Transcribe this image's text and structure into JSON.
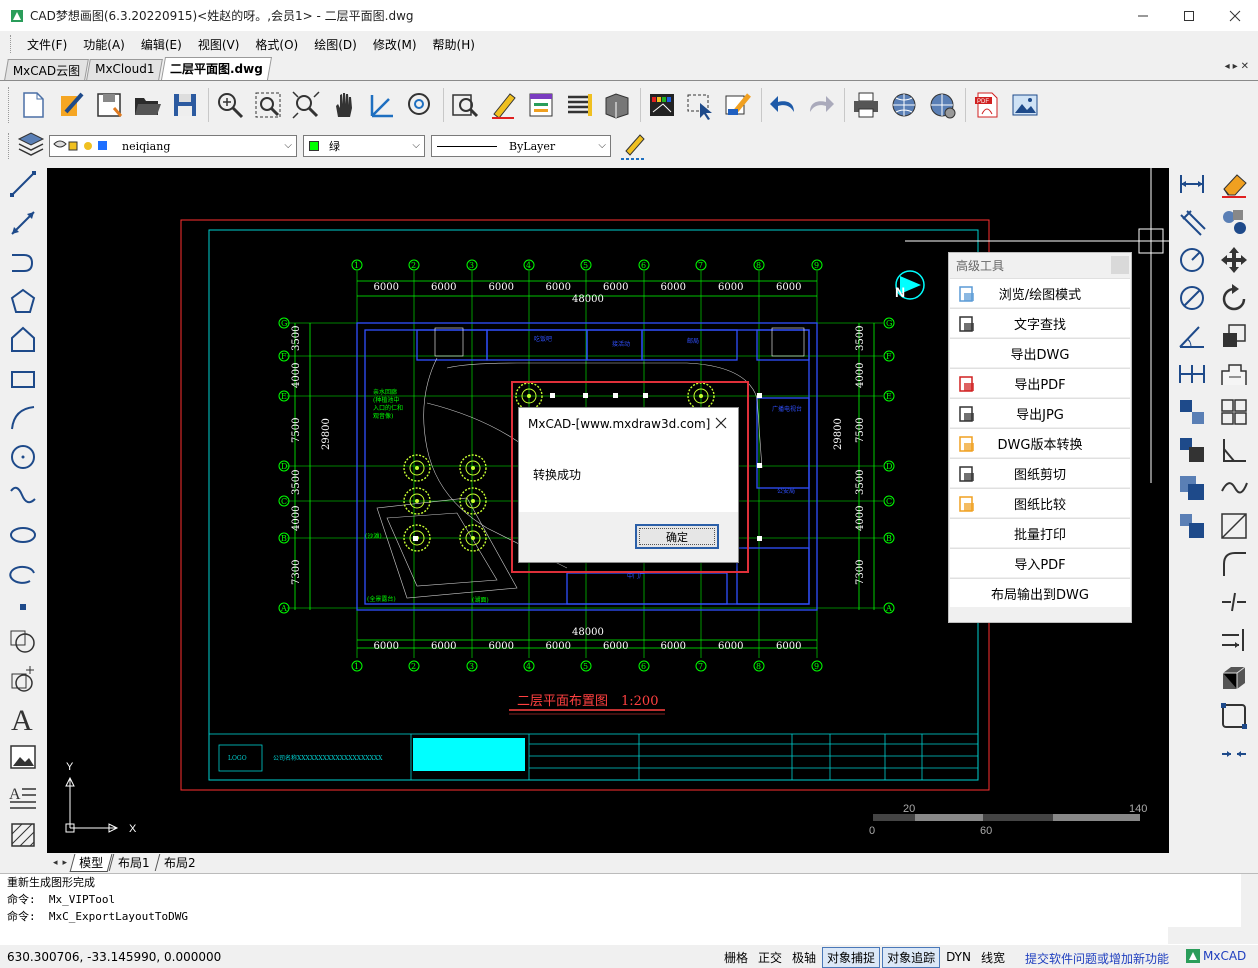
{
  "window": {
    "title": "CAD梦想画图(6.3.20220915)<姓赵的呀。,会员1> - 二层平面图.dwg"
  },
  "menu": [
    "文件(F)",
    "功能(A)",
    "编辑(E)",
    "视图(V)",
    "格式(O)",
    "绘图(D)",
    "修改(M)",
    "帮助(H)"
  ],
  "doc_tabs": [
    {
      "label": "MxCAD云图",
      "active": false
    },
    {
      "label": "MxCloud1",
      "active": false
    },
    {
      "label": "二层平面图.dwg",
      "active": true
    }
  ],
  "properties": {
    "layer": "neiqiang",
    "color": "绿",
    "linetype": "ByLayer"
  },
  "drawing": {
    "title": "二层平面布置图　1:200",
    "grid_top": [
      "1",
      "2",
      "3",
      "4",
      "5",
      "6",
      "7",
      "8",
      "9"
    ],
    "grid_side": [
      "G",
      "F",
      "E",
      "D",
      "C",
      "B",
      "A"
    ],
    "dims_top": [
      "6000",
      "6000",
      "6000",
      "6000",
      "6000",
      "6000",
      "6000",
      "6000"
    ],
    "dim_total": "48000",
    "dims_left": [
      "3500",
      "4000",
      "7500",
      "3500",
      "4000",
      "7300"
    ],
    "dim_side_total": "29800",
    "north": "N",
    "logo_text": "LOGO",
    "company_label": "公司名称XXXXXXXXXXXXXXXXXXXX",
    "scale_labels": [
      "20",
      "140",
      "0",
      "60"
    ],
    "axis": {
      "x": "X",
      "y": "Y"
    }
  },
  "layout_tabs": [
    {
      "label": "模型",
      "active": true
    },
    {
      "label": "布局1",
      "active": false
    },
    {
      "label": "布局2",
      "active": false
    }
  ],
  "command_lines": [
    "重新生成图形完成",
    "命令:  Mx_VIPTool",
    "命令:  MxC_ExportLayoutToDWG"
  ],
  "status": {
    "coords": "630.300706,  -33.145990,  0.000000",
    "toggles": [
      {
        "label": "栅格",
        "on": false
      },
      {
        "label": "正交",
        "on": false
      },
      {
        "label": "极轴",
        "on": false
      },
      {
        "label": "对象捕捉",
        "on": true
      },
      {
        "label": "对象追踪",
        "on": true
      },
      {
        "label": "DYN",
        "on": false
      },
      {
        "label": "线宽",
        "on": false
      }
    ],
    "feedback": "提交软件问题或增加新功能",
    "brand": "MxCAD"
  },
  "adv_panel": {
    "title": "高级工具",
    "items": [
      {
        "label": "浏览/绘图模式",
        "icon": "browse-mode-icon"
      },
      {
        "label": "文字查找",
        "icon": "text-find-icon"
      },
      {
        "label": "导出DWG",
        "icon": ""
      },
      {
        "label": "导出PDF",
        "icon": "pdf-export-icon"
      },
      {
        "label": "导出JPG",
        "icon": "jpg-export-icon"
      },
      {
        "label": "DWG版本转换",
        "icon": "dwg-convert-icon"
      },
      {
        "label": "图纸剪切",
        "icon": "drawing-cut-icon"
      },
      {
        "label": "图纸比较",
        "icon": "drawing-compare-icon"
      },
      {
        "label": "批量打印",
        "icon": ""
      },
      {
        "label": "导入PDF",
        "icon": ""
      },
      {
        "label": "布局输出到DWG",
        "icon": ""
      }
    ]
  },
  "dialog": {
    "title": "MxCAD-[www.mxdraw3d.com]",
    "message": "转换成功",
    "ok_label": "确定"
  },
  "colors": {
    "canvas": "#000000",
    "grid": "#00ff00",
    "walls": "#3050ff",
    "frame": "#ff3030",
    "cyan": "#00ffff",
    "highlight": "#e0303a"
  }
}
